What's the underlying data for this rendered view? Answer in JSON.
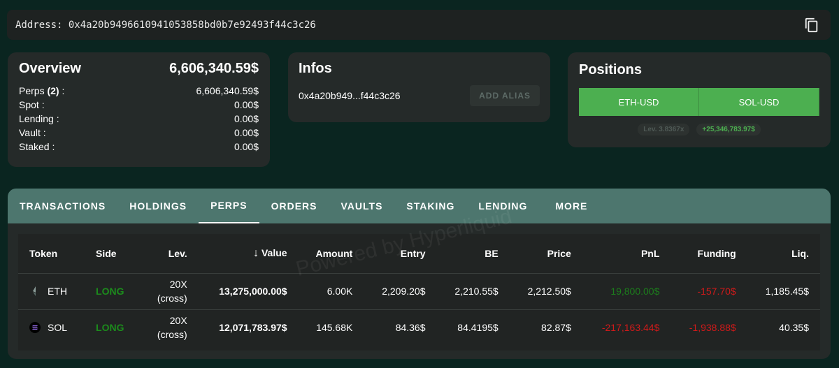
{
  "address": {
    "label": "Address: 0x4a20b9496610941053858bd0b7e92493f44c3c26"
  },
  "overview": {
    "title": "Overview",
    "total": "6,606,340.59$",
    "rows": [
      {
        "label": "Perps",
        "count": "(2)",
        "suffix": " :",
        "value": "6,606,340.59$"
      },
      {
        "label": "Spot :",
        "value": "0.00$"
      },
      {
        "label": "Lending :",
        "value": "0.00$"
      },
      {
        "label": "Vault :",
        "value": "0.00$"
      },
      {
        "label": "Staked :",
        "value": "0.00$"
      }
    ]
  },
  "infos": {
    "title": "Infos",
    "short_address": "0x4a20b949...f44c3c26",
    "alias_button": "ADD ALIAS"
  },
  "positions": {
    "title": "Positions",
    "buttons": [
      "ETH-USD",
      "SOL-USD"
    ],
    "leverage": "Lev. 3.8367x",
    "pnl": "+25,346,783.97$"
  },
  "tabs": [
    "TRANSACTIONS",
    "HOLDINGS",
    "PERPS",
    "ORDERS",
    "VAULTS",
    "STAKING",
    "LENDING",
    "MORE"
  ],
  "active_tab": "PERPS",
  "table": {
    "headers": [
      "Token",
      "Side",
      "Lev.",
      "Value",
      "Amount",
      "Entry",
      "BE",
      "Price",
      "PnL",
      "Funding",
      "Liq."
    ],
    "sort_icon": "arrow-down-icon",
    "rows": [
      {
        "token": "ETH",
        "side": "LONG",
        "lev": "20X",
        "mode": "(cross)",
        "value": "13,275,000.00$",
        "amount": "6.00K",
        "entry": "2,209.20$",
        "be": "2,210.55$",
        "price": "2,212.50$",
        "pnl": "19,800.00$",
        "funding": "-157.70$",
        "liq": "1,185.45$"
      },
      {
        "token": "SOL",
        "side": "LONG",
        "lev": "20X",
        "mode": "(cross)",
        "value": "12,071,783.97$",
        "amount": "145.68K",
        "entry": "84.36$",
        "be": "84.4195$",
        "price": "82.87$",
        "pnl": "-217,163.44$",
        "funding": "-1,938.88$",
        "liq": "40.35$"
      }
    ]
  },
  "watermark": "Powered by Hyperliquid"
}
